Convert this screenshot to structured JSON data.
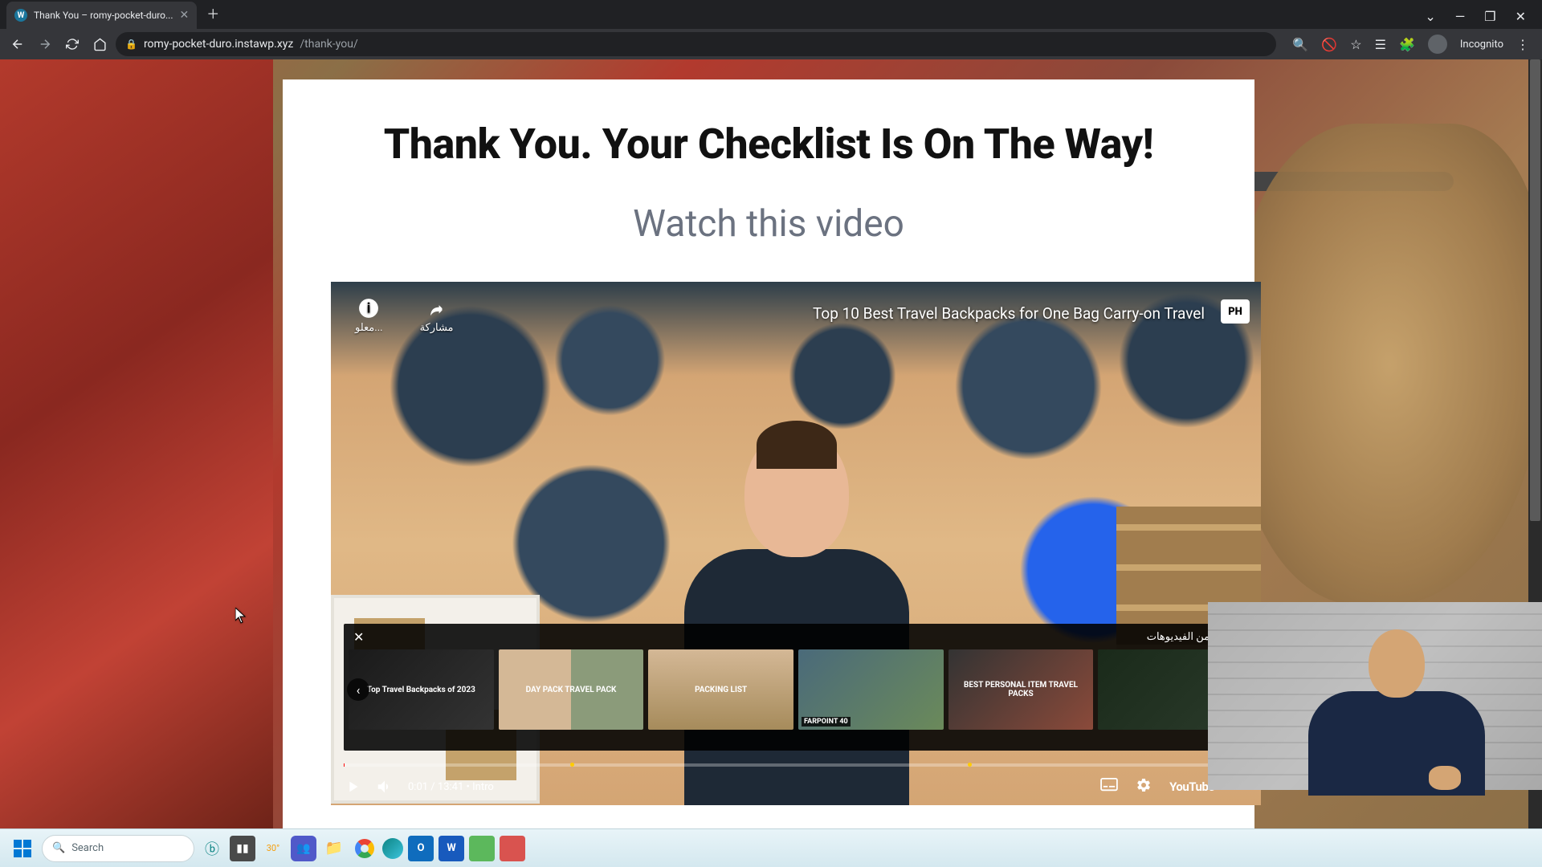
{
  "browser": {
    "tab_title": "Thank You – romy-pocket-duro...",
    "url_host": "romy-pocket-duro.instawp.xyz",
    "url_path": "/thank-you/",
    "profile_label": "Incognito"
  },
  "page": {
    "headline": "Thank You. Your Checklist Is On The Way!",
    "subhead": "Watch this video"
  },
  "video": {
    "title": "Top 10 Best Travel Backpacks for One Bag Carry-on Travel",
    "channel_badge": "PH",
    "top_info_label": "معلو...",
    "top_share_label": "مشاركة",
    "time_current": "0:01",
    "time_total": "13:41",
    "chapter": "Intro",
    "more_videos_label": "المزيد من الفيديوهات",
    "youtube_label": "YouTube",
    "thumbs": [
      "Top Travel Backpacks of 2023",
      "DAY PACK  TRAVEL PACK",
      "PACKING LIST",
      "FARPOINT 40",
      "BEST PERSONAL ITEM TRAVEL PACKS",
      ""
    ]
  },
  "taskbar": {
    "search_placeholder": "Search",
    "weather_temp": "30°"
  }
}
